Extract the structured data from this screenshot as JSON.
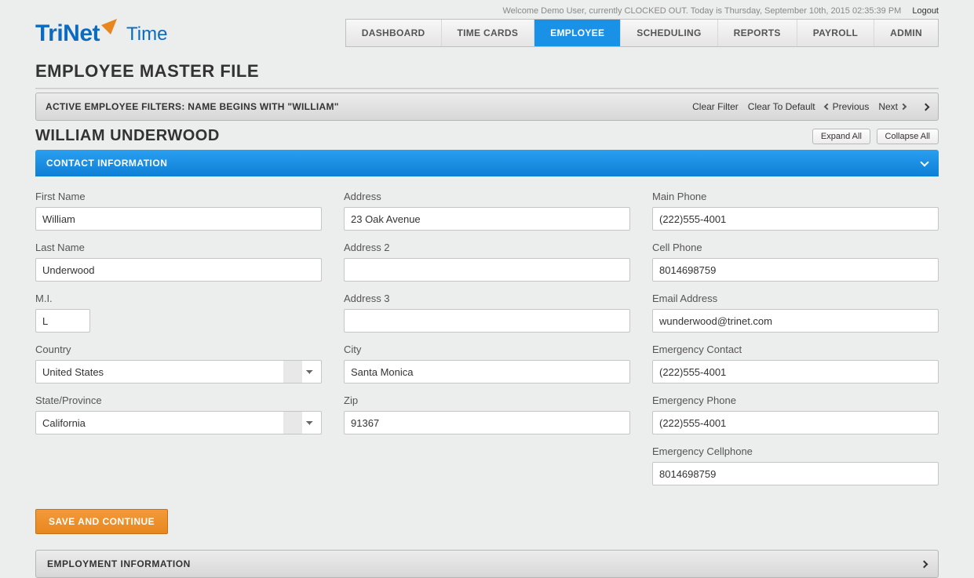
{
  "topbar": {
    "welcome": "Welcome Demo User, currently CLOCKED OUT. Today is Thursday, September 10th, 2015 02:35:39 PM",
    "logout": "Logout"
  },
  "logo": {
    "brand": "TriNet",
    "product": "Time"
  },
  "nav": {
    "items": [
      "DASHBOARD",
      "TIME CARDS",
      "EMPLOYEE",
      "SCHEDULING",
      "REPORTS",
      "PAYROLL",
      "ADMIN"
    ],
    "activeIndex": 2
  },
  "page_title": "EMPLOYEE MASTER FILE",
  "filterbar": {
    "text": "ACTIVE EMPLOYEE FILTERS: NAME BEGINS WITH \"WILLIAM\"",
    "clear_filter": "Clear Filter",
    "clear_default": "Clear To Default",
    "previous": "Previous",
    "next": "Next"
  },
  "employee_name": "WILLIAM UNDERWOOD",
  "buttons": {
    "expand_all": "Expand All",
    "collapse_all": "Collapse All",
    "save_continue": "SAVE AND CONTINUE"
  },
  "sections": {
    "contact": "CONTACT INFORMATION",
    "employment": "EMPLOYMENT INFORMATION"
  },
  "labels": {
    "first_name": "First Name",
    "last_name": "Last Name",
    "mi": "M.I.",
    "country": "Country",
    "state": "State/Province",
    "address": "Address",
    "address2": "Address 2",
    "address3": "Address 3",
    "city": "City",
    "zip": "Zip",
    "main_phone": "Main Phone",
    "cell_phone": "Cell Phone",
    "email": "Email Address",
    "emergency_contact": "Emergency Contact",
    "emergency_phone": "Emergency Phone",
    "emergency_cell": "Emergency Cellphone"
  },
  "values": {
    "first_name": "William",
    "last_name": "Underwood",
    "mi": "L",
    "country": "United States",
    "state": "California",
    "address": "23 Oak Avenue",
    "address2": "",
    "address3": "",
    "city": "Santa Monica",
    "zip": "91367",
    "main_phone": "(222)555-4001",
    "cell_phone": "8014698759",
    "email": "wunderwood@trinet.com",
    "emergency_contact": "(222)555-4001",
    "emergency_phone": "(222)555-4001",
    "emergency_cell": "8014698759"
  }
}
